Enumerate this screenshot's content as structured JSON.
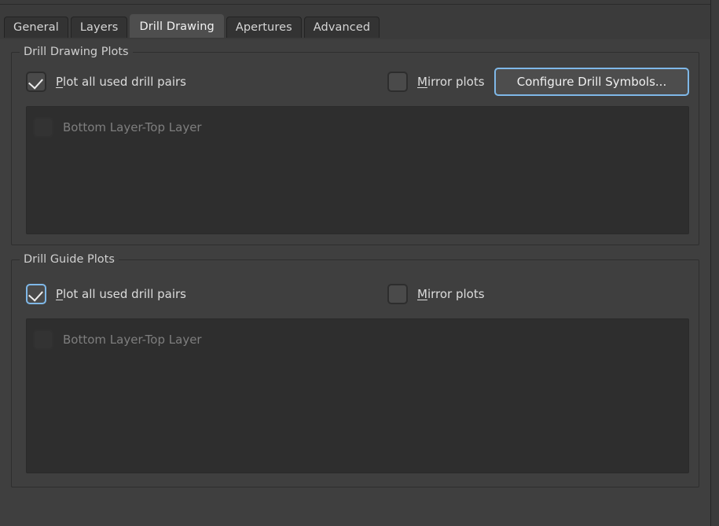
{
  "window": {
    "accent_blue": "#7fb8e8",
    "bg": "#3f3f3f",
    "panel_bg": "#2e2e2e"
  },
  "tabs": [
    {
      "label": "General",
      "selected": false
    },
    {
      "label": "Layers",
      "selected": false
    },
    {
      "label": "Drill Drawing",
      "selected": true
    },
    {
      "label": "Apertures",
      "selected": false
    },
    {
      "label": "Advanced",
      "selected": false
    }
  ],
  "drill_drawing_plots": {
    "title": "Drill Drawing Plots",
    "plot_all": {
      "label_mnemonic": "P",
      "label_rest": "lot all used drill pairs",
      "checked": true,
      "focused": false
    },
    "mirror": {
      "label_mnemonic": "M",
      "label_rest": "irror plots",
      "checked": false,
      "focused": false
    },
    "configure_button": {
      "label": "Configure Drill Symbols...",
      "is_default": true
    },
    "list_items": [
      {
        "label": "Bottom Layer-Top Layer",
        "checked": false,
        "disabled": true
      }
    ]
  },
  "drill_guide_plots": {
    "title": "Drill Guide Plots",
    "plot_all": {
      "label_mnemonic": "P",
      "label_rest": "lot all used drill pairs",
      "checked": true,
      "focused": true
    },
    "mirror": {
      "label_mnemonic": "M",
      "label_rest": "irror plots",
      "checked": false,
      "focused": false
    },
    "list_items": [
      {
        "label": "Bottom Layer-Top Layer",
        "checked": false,
        "disabled": true
      }
    ]
  }
}
